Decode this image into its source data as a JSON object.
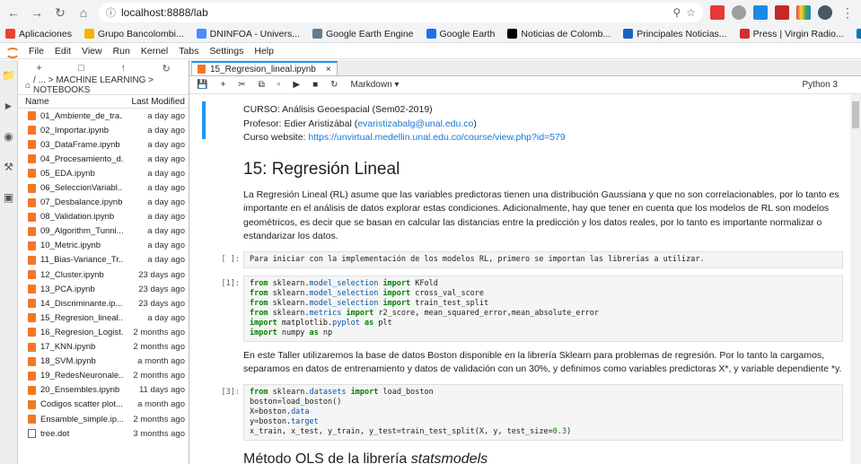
{
  "browser": {
    "url": "localhost:8888/lab",
    "bookmarks": [
      "Aplicaciones",
      "Grupo Bancolombi...",
      "DNINFOA - Univers...",
      "Google Earth Engine",
      "Google Earth",
      "Noticias de Colomb...",
      "Principales Noticias...",
      "Press | Virgin Radio...",
      "Trello"
    ],
    "bookmark_colors": [
      "#ea4335",
      "#f4b400",
      "#4a8cff",
      "#607d8b",
      "#1a73e8",
      "#000000",
      "#1565c0",
      "#d32f2f",
      "#0079bf"
    ]
  },
  "menu": [
    "File",
    "Edit",
    "View",
    "Run",
    "Kernel",
    "Tabs",
    "Settings",
    "Help"
  ],
  "filebrowser": {
    "breadcrumb": "/ ... > MACHINE LEARNING > NOTEBOOKS",
    "col_name": "Name",
    "col_modified": "Last Modified",
    "files": [
      {
        "name": "01_Ambiente_de_tra...",
        "date": "a day ago",
        "type": "nb"
      },
      {
        "name": "02_Importar.ipynb",
        "date": "a day ago",
        "type": "nb"
      },
      {
        "name": "03_DataFrame.ipynb",
        "date": "a day ago",
        "type": "nb"
      },
      {
        "name": "04_Procesamiento_d...",
        "date": "a day ago",
        "type": "nb"
      },
      {
        "name": "05_EDA.ipynb",
        "date": "a day ago",
        "type": "nb"
      },
      {
        "name": "06_SeleccionVariabl...",
        "date": "a day ago",
        "type": "nb"
      },
      {
        "name": "07_Desbalance.ipynb",
        "date": "a day ago",
        "type": "nb"
      },
      {
        "name": "08_Validation.ipynb",
        "date": "a day ago",
        "type": "nb"
      },
      {
        "name": "09_Algorithm_Tunni...",
        "date": "a day ago",
        "type": "nb"
      },
      {
        "name": "10_Metric.ipynb",
        "date": "a day ago",
        "type": "nb"
      },
      {
        "name": "11_Bias-Variance_Tr...",
        "date": "a day ago",
        "type": "nb"
      },
      {
        "name": "12_Cluster.ipynb",
        "date": "23 days ago",
        "type": "nb"
      },
      {
        "name": "13_PCA.ipynb",
        "date": "23 days ago",
        "type": "nb"
      },
      {
        "name": "14_Discriminante.ip...",
        "date": "23 days ago",
        "type": "nb"
      },
      {
        "name": "15_Regresion_lineal....",
        "date": "a day ago",
        "type": "nb"
      },
      {
        "name": "16_Regresion_Logist...",
        "date": "2 months ago",
        "type": "nb"
      },
      {
        "name": "17_KNN.ipynb",
        "date": "2 months ago",
        "type": "nb"
      },
      {
        "name": "18_SVM.ipynb",
        "date": "a month ago",
        "type": "nb"
      },
      {
        "name": "19_RedesNeuronale...",
        "date": "2 months ago",
        "type": "nb"
      },
      {
        "name": "20_Ensembles.ipynb",
        "date": "11 days ago",
        "type": "nb"
      },
      {
        "name": "Codigos scatter plot...",
        "date": "a month ago",
        "type": "nb"
      },
      {
        "name": "Ensamble_simple.ip...",
        "date": "2 months ago",
        "type": "nb"
      },
      {
        "name": "tree.dot",
        "date": "3 months ago",
        "type": "doc"
      }
    ]
  },
  "tab": {
    "title": "15_Regresion_lineal.ipynb",
    "close": "×"
  },
  "toolbar": {
    "cell_type": "Markdown",
    "kernel": "Python 3"
  },
  "notebook": {
    "header": {
      "line1": "CURSO: Análisis Geoespacial (Sem02-2019)",
      "line2_prefix": "Profesor: Edier Aristizábal (",
      "email": "evaristizabalg@unal.edu.co",
      "line2_suffix": ")",
      "line3_prefix": "Curso website: ",
      "website": "https://unvirtual.medellin.unal.edu.co/course/view.php?id=579"
    },
    "title": "15: Regresión Lineal",
    "intro": "La Regresión Lineal (RL) asume que las variables predictoras tienen una distribución Gaussiana y que no son correlacionables, por lo tanto es importante en el análisis de datos explorar estas condiciones. Adicionalmente, hay que tener en cuenta que los modelos de RL son modelos geométricos, es decir que se basan en calcular las distancias entre la predicción y los datos reales, por lo tanto es importante normalizar o estandarizar los datos.",
    "cell1_prompt": "[ ]:",
    "cell1_text": "Para iniciar con la implementación de los modelos RL, primero se importan las librerías a utilizar.",
    "cell2_prompt": "[1]:",
    "boston_text": "En este Taller utilizaremos la base de datos Boston disponible en la librería Sklearn para problemas de regresión. Por lo tanto la cargamos, separamos en datos de entrenamiento y datos de validación con un 30%, y definimos como variables predictoras X*, y variable dependiente *y.",
    "cell3_prompt": "[3]:",
    "section": "Método OLS de la librería ",
    "section_em": "statsmodels"
  }
}
